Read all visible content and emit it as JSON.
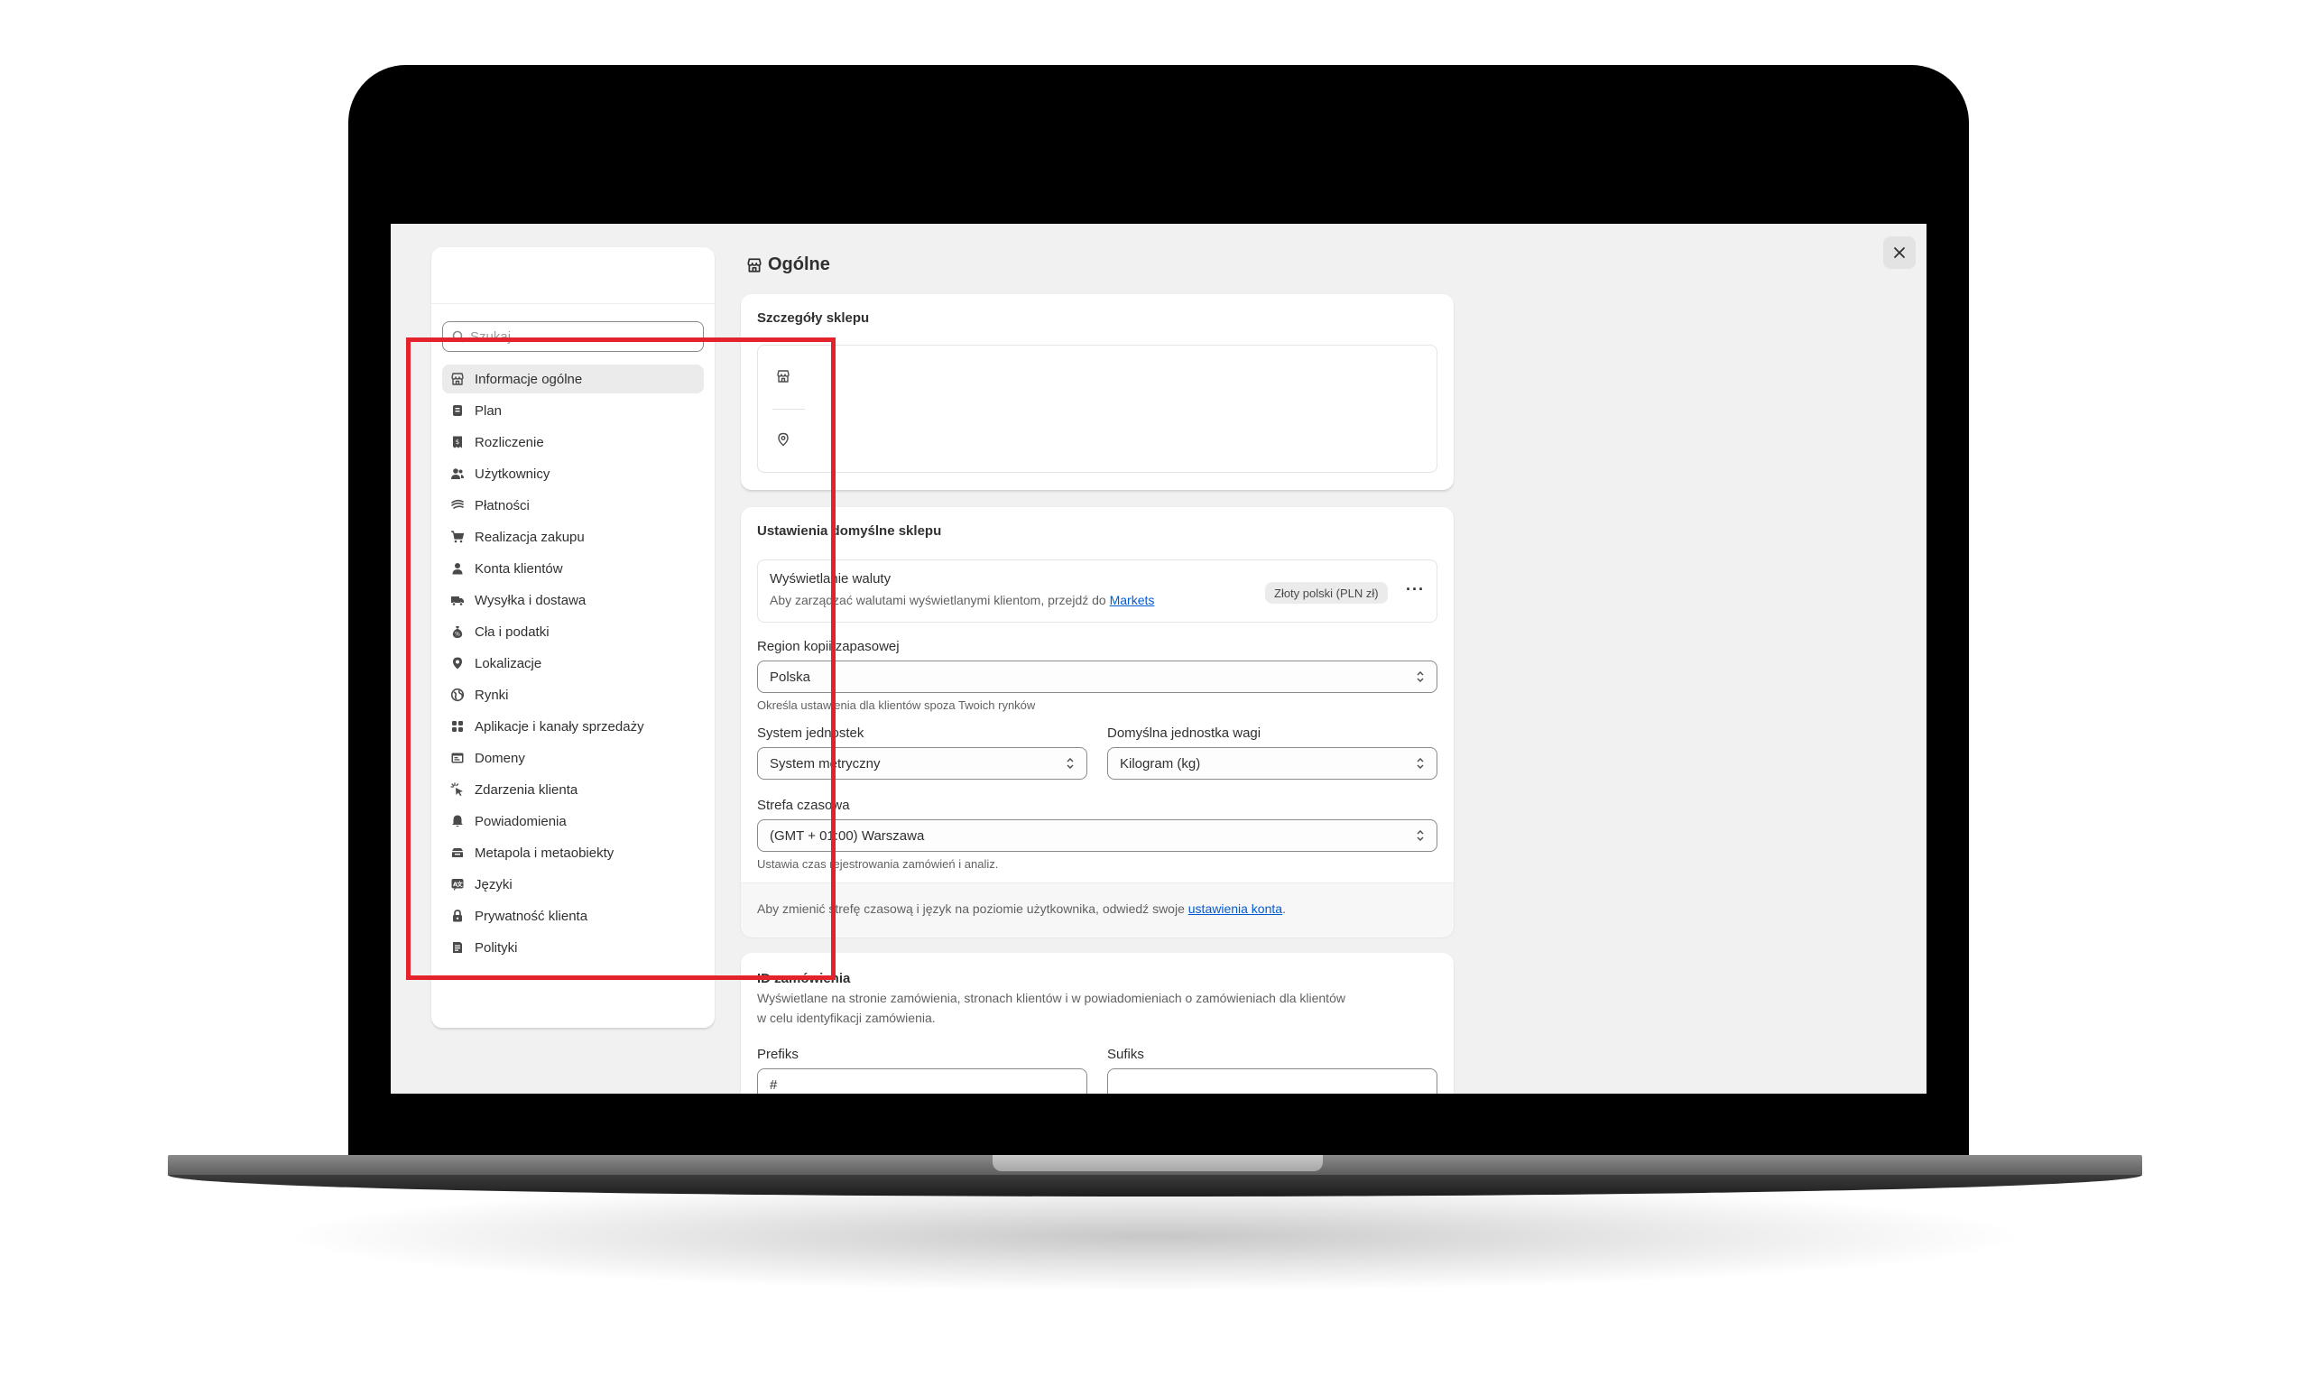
{
  "colors": {
    "accent_link": "#005bd3",
    "highlight": "#e3222b",
    "screen_bg": "#f1f1f1"
  },
  "sidebar": {
    "search_placeholder": "Szukaj",
    "items": [
      {
        "label": "Informacje ogólne",
        "icon": "store-icon",
        "active": true
      },
      {
        "label": "Plan",
        "icon": "plan-icon"
      },
      {
        "label": "Rozliczenie",
        "icon": "receipt-icon"
      },
      {
        "label": "Użytkownicy",
        "icon": "users-icon"
      },
      {
        "label": "Płatności",
        "icon": "payment-icon"
      },
      {
        "label": "Realizacja zakupu",
        "icon": "cart-icon"
      },
      {
        "label": "Konta klientów",
        "icon": "person-icon"
      },
      {
        "label": "Wysyłka i dostawa",
        "icon": "truck-icon"
      },
      {
        "label": "Cła i podatki",
        "icon": "tax-bag-icon"
      },
      {
        "label": "Lokalizacje",
        "icon": "location-icon"
      },
      {
        "label": "Rynki",
        "icon": "globe-icon"
      },
      {
        "label": "Aplikacje i kanały sprzedaży",
        "icon": "apps-icon"
      },
      {
        "label": "Domeny",
        "icon": "domain-icon"
      },
      {
        "label": "Zdarzenia klienta",
        "icon": "events-icon"
      },
      {
        "label": "Powiadomienia",
        "icon": "bell-icon"
      },
      {
        "label": "Metapola i metaobiekty",
        "icon": "metafields-icon"
      },
      {
        "label": "Języki",
        "icon": "language-icon"
      },
      {
        "label": "Prywatność klienta",
        "icon": "lock-icon"
      },
      {
        "label": "Polityki",
        "icon": "policy-icon"
      }
    ]
  },
  "main": {
    "title": "Ogólne",
    "store_details": {
      "title": "Szczegóły sklepu"
    },
    "defaults": {
      "title": "Ustawienia domyślne sklepu",
      "currency": {
        "title": "Wyświetlanie waluty",
        "help_prefix": "Aby zarządzać walutami wyświetlanymi klientom, przejdź do",
        "help_link": "Markets",
        "badge": "Złoty polski (PLN zł)"
      },
      "backup_region": {
        "label": "Region kopii zapasowej",
        "value": "Polska",
        "help": "Określa ustawienia dla klientów spoza Twoich rynków"
      },
      "unit_system": {
        "label": "System jednostek",
        "value": "System metryczny"
      },
      "weight_unit": {
        "label": "Domyślna jednostka wagi",
        "value": "Kilogram (kg)"
      },
      "timezone": {
        "label": "Strefa czasowa",
        "value": "(GMT + 01:00) Warszawa",
        "help": "Ustawia czas rejestrowania zamówień i analiz."
      },
      "footer_prefix": "Aby zmienić strefę czasową i język na poziomie użytkownika, odwiedź swoje",
      "footer_link": "ustawienia konta",
      "footer_suffix": "."
    },
    "order_id": {
      "title": "ID zamówienia",
      "desc_line1": "Wyświetlane na stronie zamówienia, stronach klientów i w powiadomieniach o zamówieniach dla klientów",
      "desc_line2": "w celu identyfikacji zamówienia.",
      "prefix_label": "Prefiks",
      "prefix_value": "#",
      "suffix_label": "Sufiks",
      "suffix_value": ""
    }
  }
}
